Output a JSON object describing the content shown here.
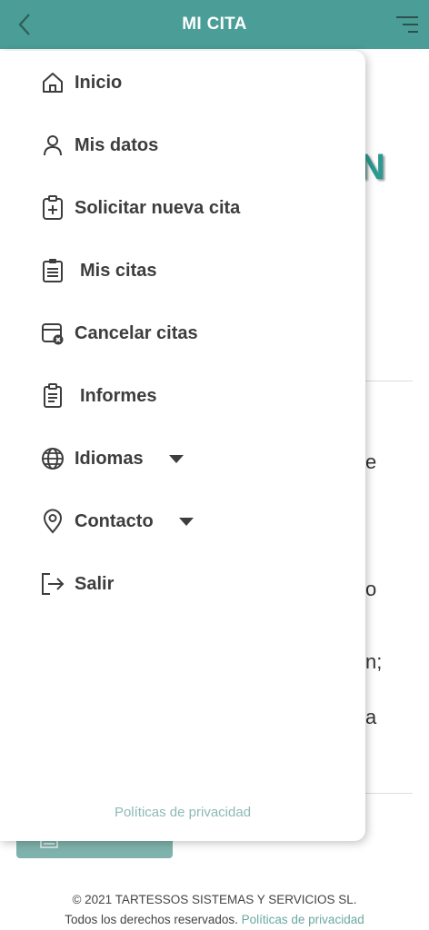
{
  "header": {
    "title": "MI CITA"
  },
  "background": {
    "heading_fragment": "N",
    "text_fragments": [
      "e",
      "o",
      "n;",
      "a"
    ]
  },
  "menu": {
    "items": [
      {
        "label": "Inicio",
        "icon": "home-icon"
      },
      {
        "label": "Mis datos",
        "icon": "user-icon"
      },
      {
        "label": "Solicitar nueva cita",
        "icon": "clipboard-plus-icon"
      },
      {
        "label": "Mis citas",
        "icon": "clipboard-list-icon"
      },
      {
        "label": "Cancelar citas",
        "icon": "calendar-cancel-icon"
      },
      {
        "label": "Informes",
        "icon": "report-icon"
      },
      {
        "label": "Idiomas",
        "icon": "globe-icon",
        "has_dropdown": true
      },
      {
        "label": "Contacto",
        "icon": "location-pin-icon",
        "has_dropdown": true
      },
      {
        "label": "Salir",
        "icon": "logout-icon"
      }
    ],
    "privacy_link": "Políticas de privacidad"
  },
  "footer": {
    "copyright": "© 2021 TARTESSOS SISTEMAS Y SERVICIOS SL.",
    "rights": "Todos los derechos reservados.",
    "privacy_link": "Políticas de privacidad"
  },
  "colors": {
    "header": "#4a9e97",
    "link": "#6aa9a2"
  }
}
